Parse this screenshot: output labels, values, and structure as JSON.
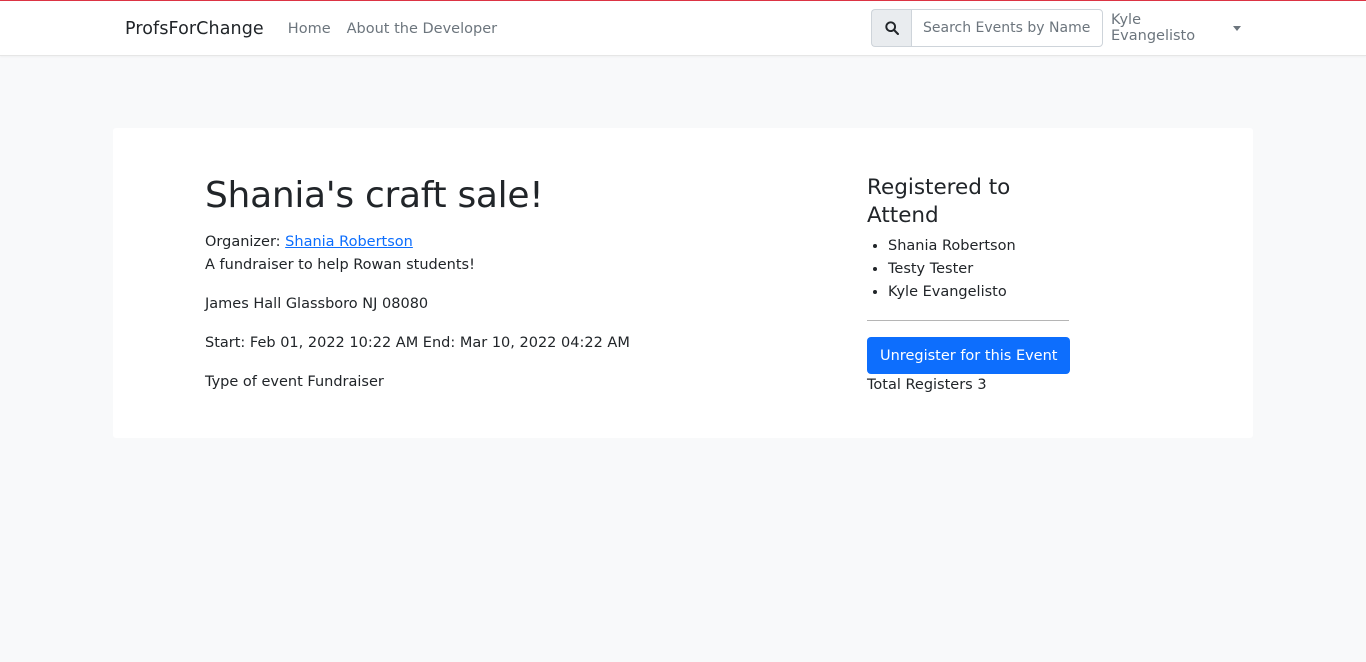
{
  "nav": {
    "brand": "ProfsForChange",
    "links": [
      "Home",
      "About the Developer"
    ],
    "search_placeholder": "Search Events by Name",
    "user_name": "Kyle Evangelisto"
  },
  "event": {
    "title": "Shania's craft sale!",
    "organizer_label": "Organizer:",
    "organizer_name": "Shania Robertson",
    "description": "A fundraiser to help Rowan students!",
    "location": "James Hall Glassboro NJ 08080",
    "schedule": "Start: Feb 01, 2022 10:22 AM End: Mar 10, 2022 04:22 AM",
    "type": "Type of event Fundraiser"
  },
  "registration": {
    "title": "Registered to Attend",
    "attendees": [
      "Shania Robertson",
      "Testy Tester",
      "Kyle Evangelisto"
    ],
    "unregister_label": "Unregister for this Event",
    "total": "Total Registers 3"
  },
  "colors": {
    "accent_top": "#dc3545",
    "primary": "#0d6efd",
    "background": "#f8f9fa"
  },
  "icons": {
    "search": "search-icon",
    "dropdown": "caret-down-icon"
  }
}
